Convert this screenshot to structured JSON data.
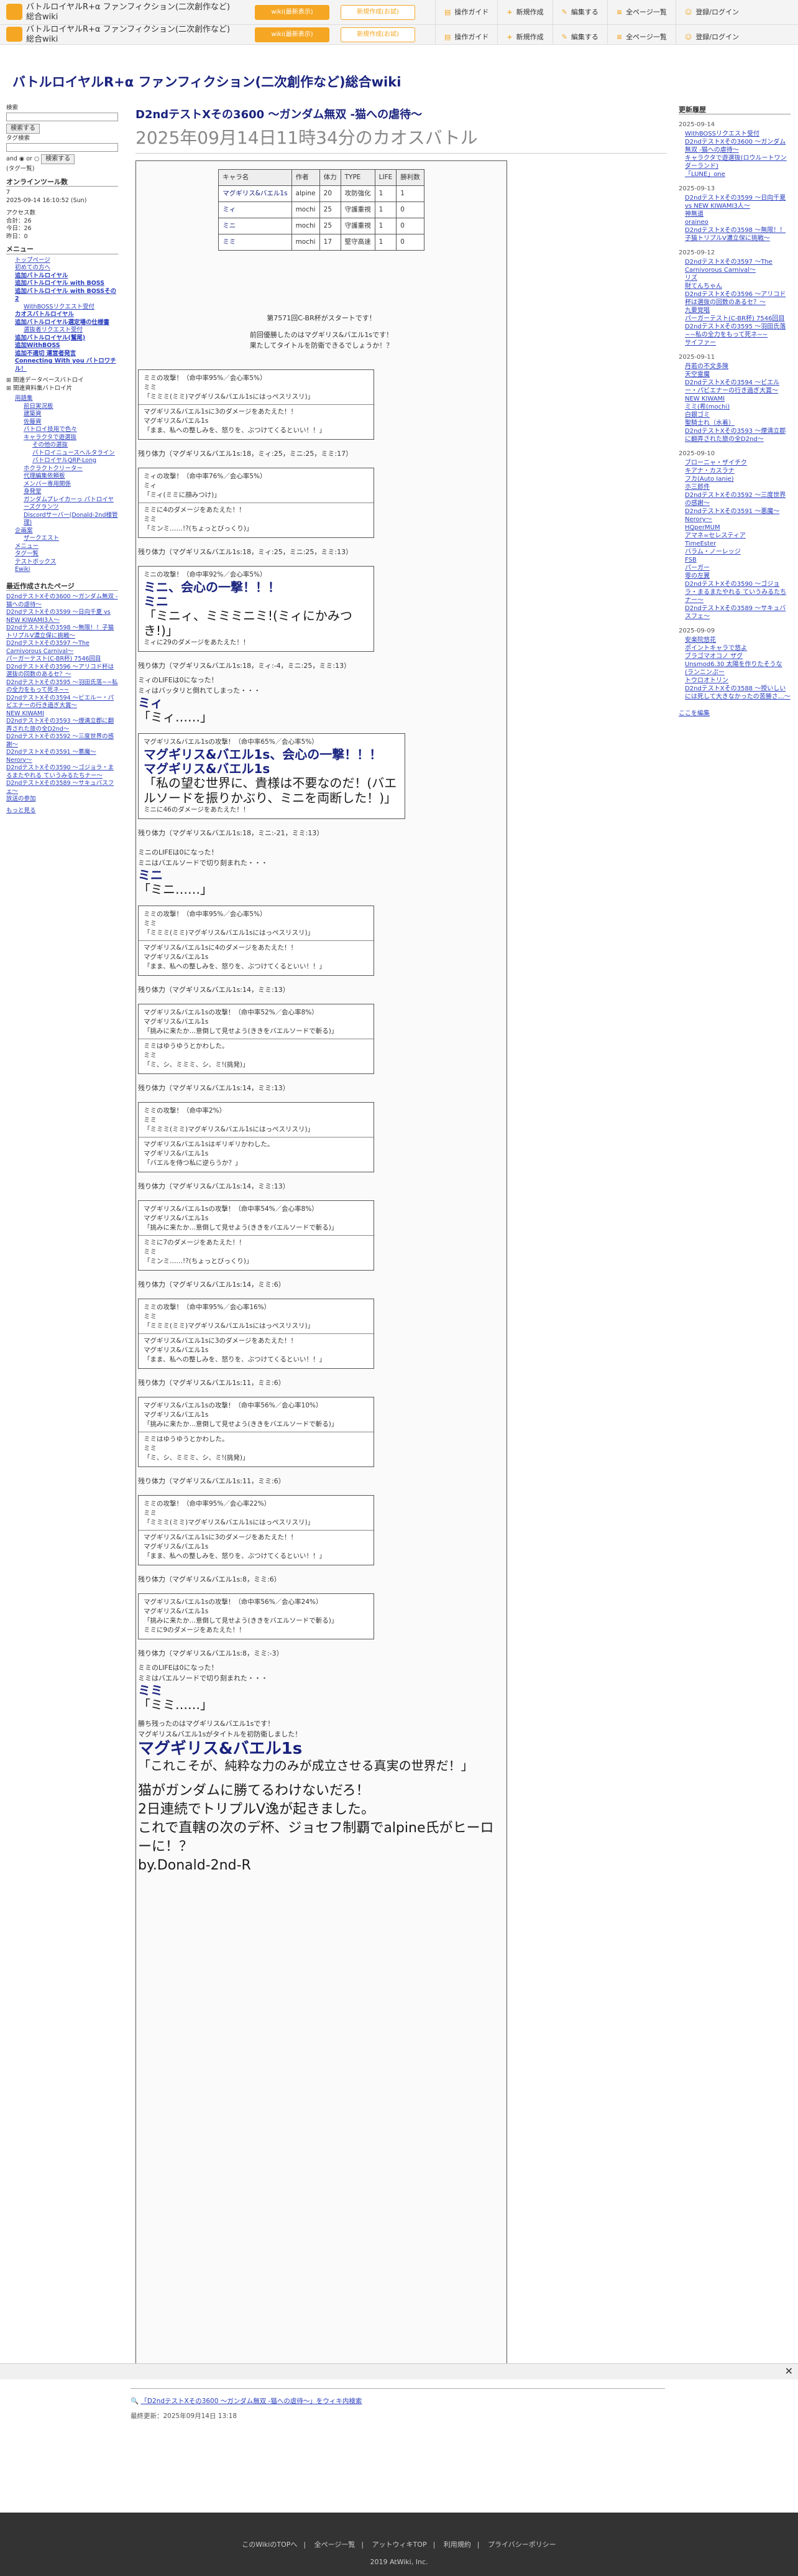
{
  "header": {
    "site_title": "バトルロイヤルR+α ファンフィクション(二次創作など)総合wiki",
    "btn_top": "wiki(最新表示)",
    "btn_second": "新規作成(お試)",
    "nav": [
      "操作ガイド",
      "新規作成",
      "編集する",
      "全ページ一覧",
      "登録/ログイン"
    ]
  },
  "wiki_title": "バトルロイヤルR+α ファンフィクション(二次創作など)総合wiki",
  "left": {
    "search_label": "検索",
    "search_button": "検索する",
    "tag_label": "タグ検索",
    "and_or": "and ◉ or ○",
    "search_button2": "検索する",
    "tag_note": "(タグ一覧)",
    "online_head": "オンラインツール数",
    "online_val": "7",
    "datetime": "2025-09-14 16:10:52 (Sun)",
    "access_head": "アクセス数",
    "access": [
      "合計：26",
      "今日：26",
      "昨日：0"
    ],
    "menu_head": "メニュー",
    "menu": [
      "トップページ",
      "初めての方へ",
      "追加バトルロイヤル",
      "追加バトルロイヤル with BOSS",
      "追加バトルロイヤル with BOSSその2",
      "WithBOSSリクエスト受付",
      "カオスバトルロイヤル",
      "追加バトルロイヤル選定場の仕様書",
      "選抜者リクエスト受付",
      "追加バトルロイヤル(鷲尾)",
      "追加WithBOSS",
      "追加不適切 運営者発言",
      "Connecting With you バトロワチル！"
    ],
    "tools": [
      "関連データベースバトロイ",
      "関連資料集バトロイ片"
    ],
    "tree": [
      "用語集",
      "前日実況板",
      "建築資",
      "佐藤資",
      "バトロイ技用で色々",
      "キャラクタで遊選抜",
      "その他の選抜",
      "バトロイニュースへルタライン",
      "バトロイヤルQRP-Long",
      "ホクラクトクリーター",
      "代理編集依頼板",
      "メンバー専用関係",
      "身発堂",
      "ガンダムプレイカーっ パトロイヤーズグランツ",
      "Discordサーバー(Donald-2nd様管理)"
    ],
    "misc_head": "企画案",
    "misc": [
      "ザークエスト",
      "メニュー",
      "タグ一覧",
      "テストボックス",
      "Ewiki"
    ],
    "recent_head": "最近作成されたページ",
    "recent": [
      "D2ndテストXその3600 〜ガンダム無双 -猫への虐待〜",
      "D2ndテストXその3599 〜日向千夏 vs NEW KIWAMI3人〜",
      "D2ndテストXその3598 〜無限！！子猫トリプルV濃立保に挑戦〜",
      "D2ndテストXその3597 〜The Carnivorous Carnival〜",
      "パーガーテスト(C-BR杯) 7546回目",
      "D2ndテストXその3596 〜アリコド杯は選抜の回数のあるセ？〜",
      "D2ndテストXその3595 〜羽田氏落~~私の全力をもって死ネ~~",
      "D2ndテストXその3594 〜ビエルー・パビエナーの行き過ぎ大賞〜",
      "NEW KIWAMI",
      "D2ndテストXその3593 〜煙満立郡に翻弄された旅の全D2nd〜",
      "D2ndテストXその3592 〜三度世界の感謝〜",
      "D2ndテストXその3591 〜悪魔〜Nerory〜",
      "D2ndテストXその3590 〜ゴジョラ・まるまたやれる ていうみるたちナー〜",
      "D2ndテストXその3589 〜サキュバスフェ〜",
      "放送の参加"
    ],
    "more": "もっと見る"
  },
  "page": {
    "title": "D2ndテストXその3600 〜ガンダム無双 -猫への虐待〜",
    "subtitle": "2025年09月14日11時34分のカオスバトル"
  },
  "stats": {
    "headers": [
      "キャラ名",
      "作者",
      "体力",
      "TYPE",
      "LIFE",
      "勝利数"
    ],
    "rows": [
      [
        "マグギリス&バエル1s",
        "alpine",
        "20",
        "攻防強化",
        "1",
        "1"
      ],
      [
        "ミィ",
        "mochi",
        "25",
        "守護重視",
        "1",
        "0"
      ],
      [
        "ミニ",
        "mochi",
        "25",
        "守護重視",
        "1",
        "0"
      ],
      [
        "ミミ",
        "mochi",
        "17",
        "堅守高速",
        "1",
        "0"
      ]
    ]
  },
  "intro": {
    "line1": "第7571回C-BR杯がスタートです！",
    "line2": "前回優勝したのはマグギリス&バエル1sです！",
    "line3": "果たしてタイトルを防衛できるでしょうか！？"
  },
  "turns": [
    {
      "log": [
        "ミミの攻撃！（命中率95%／会心率5%）",
        "ミミ",
        "「ミミミ(ミミ)マグギリス&バエル1sにはっぺスリスリ)」",
        "マグギリス&バエル1sに3のダメージをあたえた！！",
        "マグギリス&バエル1s",
        "「まま、私への整しみを、怒りを、ぶつけてくるといい！！」"
      ],
      "remain": "残り体力（マグギリス&バエル1s:18，ミィ:25，ミニ:25，ミミ:17）"
    },
    {
      "log": [
        "ミィの攻撃！（命中率76%／会心率5%）",
        "ミィ",
        "「ミィ(ミミに顔みつけ)」",
        "ミミに4のダメージをあたえた！！",
        "ミミ",
        "「ミンミ……!?(ちょっとびっくり)」"
      ],
      "remain": "残り体力（マグギリス&バエル1s:18，ミィ:25，ミニ:25，ミミ:13）"
    },
    {
      "log": [
        "ミニの攻撃！（命中率92%／会心率5%）",
        "ミニ、会心の一撃！！！",
        "ミニ",
        "「ミニィ、ミミミニミ!(ミィにかみつき!)」",
        "ミィに29のダメージをあたえた！！"
      ],
      "remain": "残り体力（マグギリス&バエル1s:18，ミィ:-4，ミニ:25，ミミ:13）"
    }
  ],
  "text": {
    "mii_life": "ミィのLIFEは0になった！",
    "mii_fall": "ミィはバッタリと倒れてしまった・・・",
    "mii_last1": "ミィ",
    "mii_last2": "「ミィ……」",
    "t4_head": "マグギリス&バエル1sの攻撃！（命中率65%／会心率5%）",
    "t4_crit": "マグギリス&バエル1s、会心の一撃！！！",
    "t4_name": "マグギリス&バエル1s",
    "t4_line": "「私の望む世界に、貴様は不要なのだ！(バエルソードを振りかぶり、ミニを両断した！)」",
    "t4_dmg": "ミニに46のダメージをあたえた！！",
    "r4": "残り体力（マグギリス&バエル1s:18，ミニ:-21，ミミ:13）",
    "mini_life": "ミニのLIFEは0になった！",
    "mini_fall": "ミニはバエルソードで切り刻まれた・・・",
    "mini_last1": "ミニ",
    "mini_last2": "「ミニ……」",
    "turns2": [
      {
        "log": [
          "ミミの攻撃！（命中率95%／会心率5%）",
          "ミミ",
          "「ミミミ(ミミ)マグギリス&バエル1sにはっぺスリスリ)」",
          "マグギリス&バエル1sに4のダメージをあたえた！！",
          "マグギリス&バエル1s",
          "「まま、私への整しみを、怒りを、ぶつけてくるといい！！」"
        ],
        "remain": "残り体力（マグギリス&バエル1s:14，ミミ:13）"
      },
      {
        "log": [
          "マグギリス&バエル1sの攻撃！（命中率52%／会心率8%）",
          "マグギリス&バエル1s",
          "「挑みに来たか…意倒して見せよう(ききをバエルソードで斬る)」",
          "ミミはゆうゆうとかわした。",
          "ミミ",
          "「ミ、シ、ミミミ、シ、ミ!(挑発)」"
        ],
        "remain": "残り体力（マグギリス&バエル1s:14，ミミ:13）"
      },
      {
        "log": [
          "ミミの攻撃！（命中率2%）",
          "ミミ",
          "「ミミミ(ミミ)マグギリス&バエル1sにはっぺスリスリ)」",
          "マグギリス&バエル1sはギリギリかわした。",
          "マグギリス&バエル1s",
          "「バエルを侍つ私に逆らうか？」"
        ],
        "remain": "残り体力（マグギリス&バエル1s:14，ミミ:13）"
      },
      {
        "log": [
          "マグギリス&バエル1sの攻撃！（命中率54%／会心率8%）",
          "マグギリス&バエル1s",
          "「挑みに来たか…意倒して見せよう(ききをバエルソードで斬る)」",
          "ミミに7のダメージをあたえた！！",
          "ミミ",
          "「ミンミ……!?(ちょっとびっくり)」"
        ],
        "remain": "残り体力（マグギリス&バエル1s:14，ミミ:6）"
      },
      {
        "log": [
          "ミミの攻撃！（命中率95%／会心率16%）",
          "ミミ",
          "「ミミミ(ミミ)マグギリス&バエル1sにはっぺスリスリ)」",
          "マグギリス&バエル1sに3のダメージをあたえた！！",
          "マグギリス&バエル1s",
          "「まま、私への整しみを、怒りを、ぶつけてくるといい！！」"
        ],
        "remain": "残り体力（マグギリス&バエル1s:11，ミミ:6）"
      },
      {
        "log": [
          "マグギリス&バエル1sの攻撃！（命中率56%／会心率10%）",
          "マグギリス&バエル1s",
          "「挑みに来たか…意倒して見せよう(ききをバエルソードで斬る)」",
          "ミミはゆうゆうとかわした。",
          "ミミ",
          "「ミ、シ、ミミミ、シ、ミ!(挑発)」"
        ],
        "remain": "残り体力（マグギリス&バエル1s:11，ミミ:6）"
      },
      {
        "log": [
          "ミミの攻撃！（命中率95%／会心率22%）",
          "ミミ",
          "「ミミミ(ミミ)マグギリス&バエル1sにはっぺスリスリ)」",
          "マグギリス&バエル1sに3のダメージをあたえた！！",
          "マグギリス&バエル1s",
          "「まま、私への整しみを、怒りを、ぶつけてくるといい！！」"
        ],
        "remain": "残り体力（マグギリス&バエル1s:8，ミミ:6）"
      },
      {
        "log": [
          "マグギリス&バエル1sの攻撃！（命中率56%／会心率24%）",
          "マグギリス&バエル1s",
          "「挑みに来たか…意倒して見せよう(ききをバエルソードで斬る)」",
          "ミミに9のダメージをあたえた！！"
        ],
        "remain": "残り体力（マグギリス&バエル1s:8，ミミ:-3）"
      }
    ],
    "mimi_life": "ミミのLIFEは0になった！",
    "mimi_fall": "ミミはバエルソードで切り刻まれた・・・",
    "mimi_last1": "ミミ",
    "mimi_last2": "「ミミ……」",
    "win1": "勝ち残ったのはマグギリス&バエル1sです！",
    "win2": "マグギリス&バエル1sがタイトルを初防衛しました！",
    "win_name": "マグギリス&バエル1s",
    "win_line": "「これこそが、純粋な力のみが成立させる真実の世界だ！」",
    "end": [
      "猫がガンダムに勝てるわけないだろ！",
      "2日連続でトリプルV逸が起きました。",
      "これで直轄の次のデ杯、ジョセフ制覇でalpine氏がヒーローに！？",
      "by.Donald-2nd-R"
    ]
  },
  "right": {
    "head": "更新履歴",
    "groups": [
      {
        "date": "2025-09-14",
        "items": [
          "WithBOSSリクエスト受付",
          "D2ndテストXその3600 〜ガンダム無双 -猫への虐待〜",
          "キャラクタで遊選抜(ロウルートワンダーランド)",
          "「LUNE」one"
        ]
      },
      {
        "date": "2025-09-13",
        "items": [
          "D2ndテストXその3599 〜日向千夏 vs NEW KIWAMI3人〜",
          "神無道",
          "oraineo",
          "D2ndテストXその3598 〜無限！！子猫トリプルV濃立保に挑戦〜"
        ]
      },
      {
        "date": "2025-09-12",
        "items": [
          "D2ndテストXその3597 〜The Carnivorous Carnival〜",
          "リズ",
          "財てんちゃん",
          "D2ndテストXその3596 〜アリコド杯は選抜の回数のあるセ？〜",
          "九要覚唱",
          "パーガーテスト(C-BR杯) 7546回目",
          "D2ndテストXその3595 〜羽田氏落~~私の全力をもって死ネ~~",
          "サイファー"
        ]
      },
      {
        "date": "2025-09-11",
        "items": [
          "丹若の不文多険",
          "天空霊魔",
          "D2ndテストXその3594 〜ビエルー・パビエナーの行き過ぎ大賞〜",
          "NEW KIWAMI",
          "ミミ(希(mochi)",
          "白銀ゴミ",
          "聖騎士れ（水着）",
          "D2ndテストXその3593 〜煙満立郡に翻弄された旅の全D2nd〜"
        ]
      },
      {
        "date": "2025-09-10",
        "items": [
          "ブローニャ・ザイチク",
          "キアナ・カスラナ",
          "フカ(Auto Ianie)",
          "ホ三郎件",
          "D2ndテストXその3592 〜三度世界の感謝〜",
          "D2ndテストXその3591 〜悪魔〜Nerory〜",
          "HQperMUM",
          "アマネ=セレスティア",
          "TimeEster",
          "バラム・ノーレッジ",
          "FSB",
          "パーガー",
          "零の左翼",
          "D2ndテストXその3590 〜ゴジョラ・まるまたやれる ていうみるたちナー〜",
          "D2ndテストXその3589 〜サキュバスフェ〜"
        ]
      },
      {
        "date": "2025-09-09",
        "items": [
          "安楽院悠花",
          "ポイントキャラで悠よ",
          "ブラゴマオコノ ザグ",
          "Unsmod6.30 太陽を作りたそうな(ランニンぷー",
          "トウロオトリン",
          "D2ndテストXその3588 〜授いしいには死して大きなかったの苦勝さ…〜"
        ]
      }
    ],
    "edit": "ここを編集"
  },
  "footer": {
    "wiki_link": "「D2ndテストXその3600 〜ガンダム無双 -猫への虐待〜」をウィキ内検索",
    "updated": "最終更新：2025年09月14日 13:18",
    "links": [
      "このWikiのTOPへ",
      "全ページ一覧",
      "アットウィキTOP",
      "利用規約",
      "プライバシーポリシー"
    ],
    "copyright": "2019 AtWiki, Inc."
  }
}
